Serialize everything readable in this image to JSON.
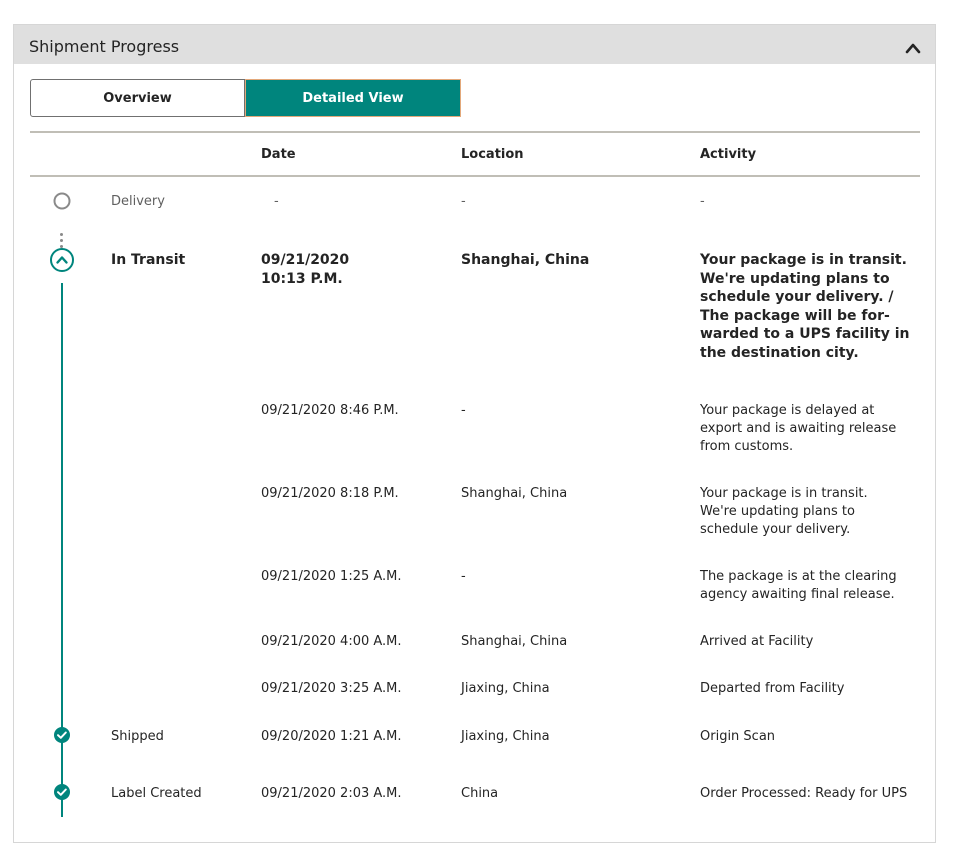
{
  "panel": {
    "title": "Shipment Progress",
    "collapse_icon": "chevron-up-icon"
  },
  "tabs": [
    {
      "label": "Overview",
      "selected": false
    },
    {
      "label": "Detailed View",
      "selected": true
    }
  ],
  "table": {
    "headers": {
      "date": "Date",
      "location": "Location",
      "activity": "Activity"
    },
    "milestones": {
      "delivery": {
        "label": "Delivery",
        "date": "-",
        "location": "-",
        "activity": "-"
      },
      "in_transit": {
        "label": "In Transit",
        "date_line1": "09/21/2020",
        "date_line2": "10:13 P.M.",
        "location": "Shanghai, China",
        "activity": "Your package is in transit. We're updating plans to schedule your delivery. / The package will be for-warded to a UPS facility in the destination city."
      },
      "shipped": {
        "label": "Shipped",
        "date": "09/20/2020  1:21 A.M.",
        "location": "Jiaxing, China",
        "activity": "Origin Scan"
      },
      "label_created": {
        "label": "Label Created",
        "date": "09/21/2020  2:03 A.M.",
        "location": "China",
        "activity": "Order Processed: Ready for UPS"
      }
    },
    "events": [
      {
        "date": "09/21/2020  8:46 P.M.",
        "location": "-",
        "activity": "Your package is delayed at export and is awaiting release from customs."
      },
      {
        "date": "09/21/2020  8:18 P.M.",
        "location": "Shanghai, China",
        "activity": "Your package is in transit. We're updating plans to schedule your delivery."
      },
      {
        "date": "09/21/2020  1:25 A.M.",
        "location": "-",
        "activity": "The package is at the clearing agency awaiting final release."
      },
      {
        "date": "09/21/2020  4:00 A.M.",
        "location": "Shanghai, China",
        "activity": "Arrived at Facility"
      },
      {
        "date": "09/21/2020  3:25 A.M.",
        "location": "Jiaxing, China",
        "activity": "Departed from Facility"
      }
    ]
  },
  "icons": {
    "pending": "empty-circle-icon",
    "current": "chevron-up-circle-icon",
    "complete": "check-circle-icon"
  },
  "colors": {
    "accent": "#00857d",
    "header_bg": "#dfdfdf",
    "muted_text": "#5f5f5f"
  }
}
